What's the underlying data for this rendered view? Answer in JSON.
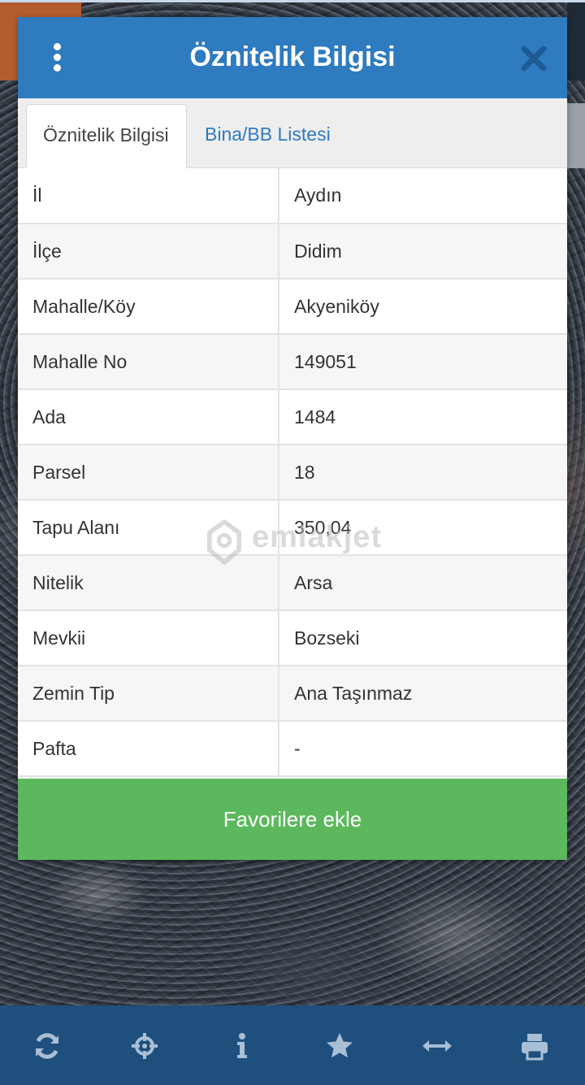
{
  "modal": {
    "title": "Öznitelik Bilgisi",
    "tabs": [
      {
        "label": "Öznitelik Bilgisi",
        "active": true
      },
      {
        "label": "Bina/BB Listesi",
        "active": false
      }
    ],
    "rows": [
      {
        "key": "İl",
        "value": "Aydın"
      },
      {
        "key": "İlçe",
        "value": "Didim"
      },
      {
        "key": "Mahalle/Köy",
        "value": "Akyeniköy"
      },
      {
        "key": "Mahalle No",
        "value": "149051"
      },
      {
        "key": "Ada",
        "value": "1484"
      },
      {
        "key": "Parsel",
        "value": "18"
      },
      {
        "key": "Tapu Alanı",
        "value": "350,04"
      },
      {
        "key": "Nitelik",
        "value": "Arsa"
      },
      {
        "key": "Mevkii",
        "value": "Bozseki"
      },
      {
        "key": "Zemin Tip",
        "value": "Ana Taşınmaz"
      },
      {
        "key": "Pafta",
        "value": "-"
      }
    ],
    "favorite_button": "Favorilere ekle"
  },
  "watermark": {
    "text": "emlakjet"
  },
  "toolbar": {
    "icons": [
      "refresh-icon",
      "crosshair-icon",
      "info-icon",
      "star-icon",
      "measure-icon",
      "print-icon"
    ]
  },
  "colors": {
    "header": "#2f7bbf",
    "tab_link": "#2f7bbf",
    "favorite_button": "#5cb85c",
    "toolbar": "#1e4f7d",
    "toolbar_icons": "#a9bfd6"
  }
}
